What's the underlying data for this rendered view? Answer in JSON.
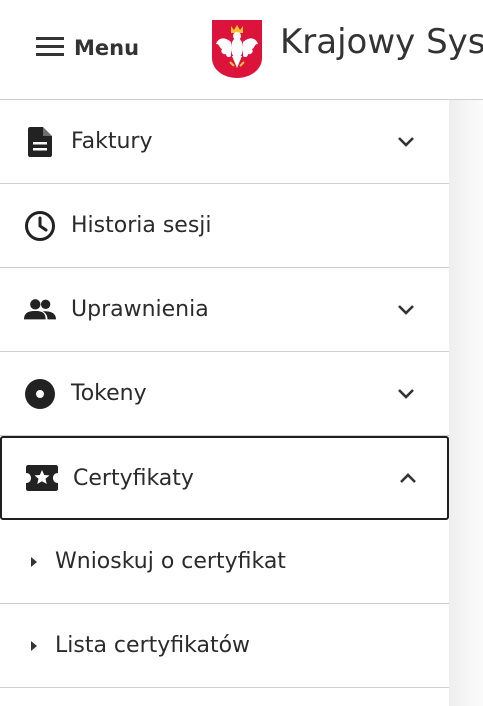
{
  "header": {
    "menu_label": "Menu",
    "app_title": "Krajowy Sys"
  },
  "sidebar": {
    "items": [
      {
        "label": "Faktury",
        "icon": "document-icon",
        "expandable": true,
        "expanded": false
      },
      {
        "label": "Historia sesji",
        "icon": "clock-icon",
        "expandable": false
      },
      {
        "label": "Uprawnienia",
        "icon": "people-icon",
        "expandable": true,
        "expanded": false
      },
      {
        "label": "Tokeny",
        "icon": "disc-icon",
        "expandable": true,
        "expanded": false
      },
      {
        "label": "Certyfikaty",
        "icon": "star-ticket-icon",
        "expandable": true,
        "expanded": true
      }
    ],
    "subitems": [
      {
        "label": "Wnioskuj o certyfikat"
      },
      {
        "label": "Lista certyfikatów"
      }
    ]
  },
  "colors": {
    "text": "#2b2b2b",
    "divider": "#cfcfcf",
    "emblem_red": "#dc143c",
    "active_border": "#1f1f1f"
  }
}
